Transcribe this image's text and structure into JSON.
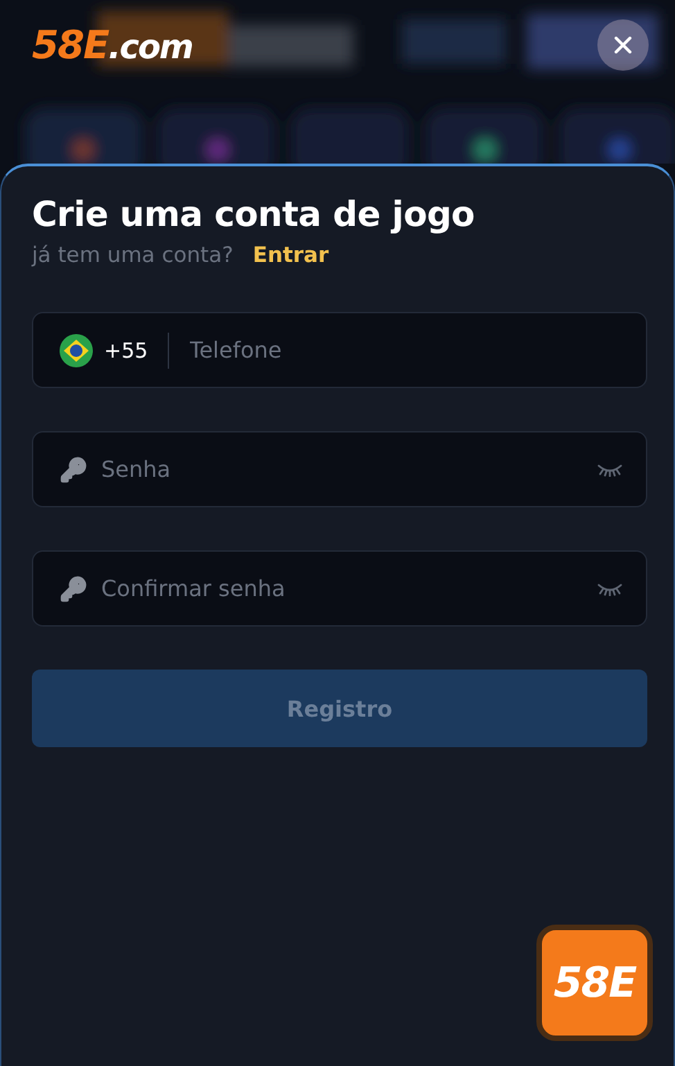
{
  "logo": {
    "brand": "58E",
    "suffix": ".com"
  },
  "form": {
    "title": "Crie uma conta de jogo",
    "prompt": "já tem uma conta?",
    "login_link": "Entrar",
    "fields": [
      {
        "kind": "phone",
        "country_code": "+55",
        "placeholder": "Telefone"
      },
      {
        "kind": "password",
        "placeholder": "Senha"
      },
      {
        "kind": "password",
        "placeholder": "Confirmar senha"
      }
    ],
    "submit": {
      "label": "Registro",
      "disabled": true
    }
  },
  "floating_app": {
    "label": "58E"
  }
}
